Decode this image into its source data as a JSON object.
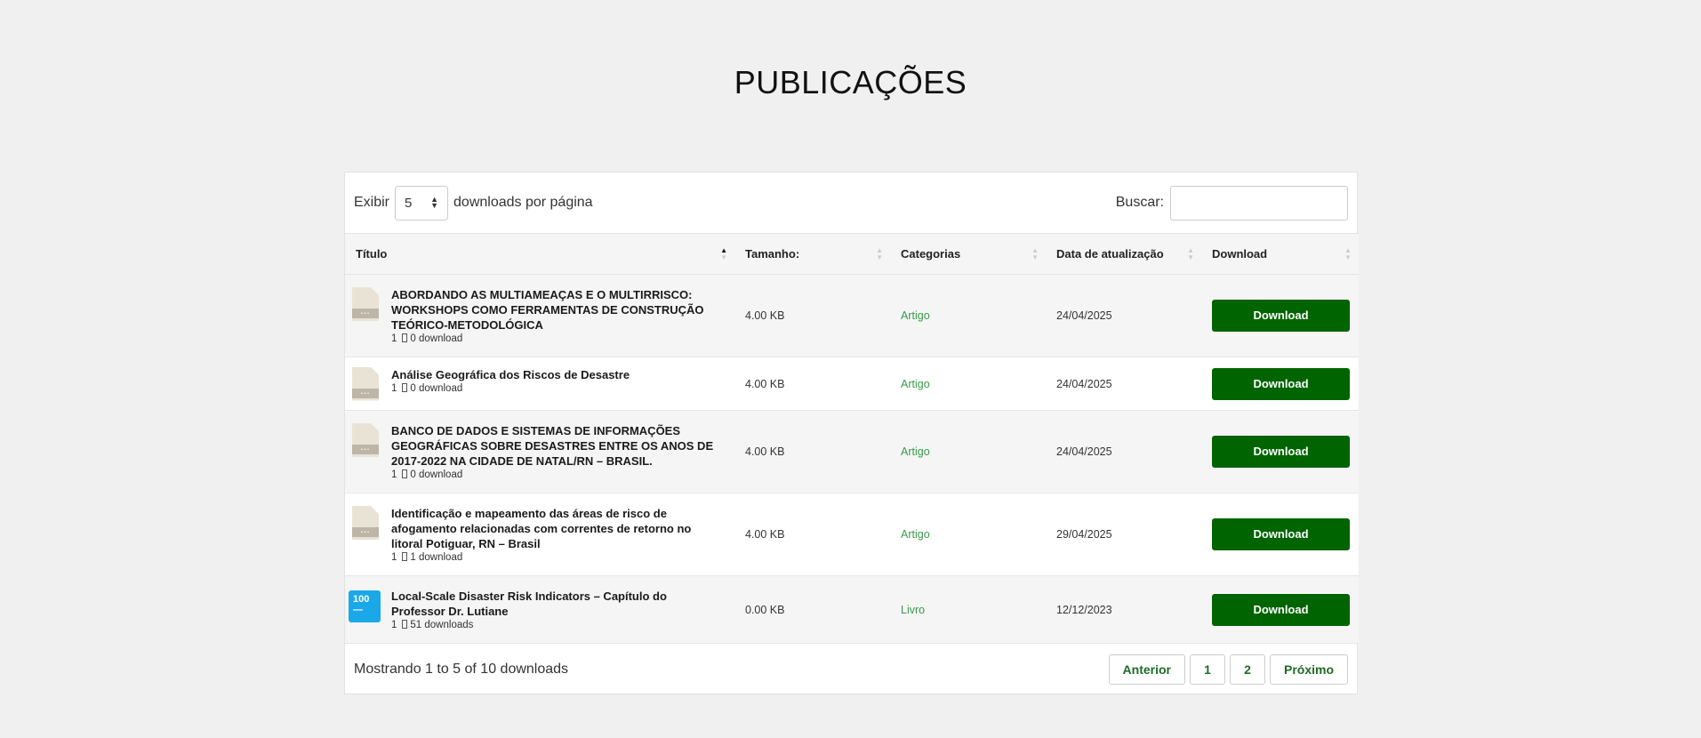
{
  "page": {
    "title": "PUBLICAÇÕES"
  },
  "controls": {
    "show_label": "Exibir",
    "page_length": "5",
    "per_page_label": "downloads por página",
    "search_label": "Buscar:",
    "search_value": ""
  },
  "columns": {
    "title": "Título",
    "size": "Tamanho:",
    "category": "Categorias",
    "date": "Data de atualização",
    "download": "Download"
  },
  "rows": [
    {
      "title": "ABORDANDO AS MULTIAMEAÇAS E O MULTIRRISCO: WORKSHOPS COMO FERRAMENTAS DE CONSTRUÇÃO TEÓRICO-METODOLÓGICA",
      "files": "1",
      "downloads": "0 download",
      "size": "4.00 KB",
      "category": "Artigo",
      "date": "24/04/2025",
      "button": "Download",
      "icon": "file-icon"
    },
    {
      "title": "Análise Geográfica dos Riscos de Desastre",
      "files": "1",
      "downloads": "0 download",
      "size": "4.00 KB",
      "category": "Artigo",
      "date": "24/04/2025",
      "button": "Download",
      "icon": "file-icon"
    },
    {
      "title": "BANCO DE DADOS E SISTEMAS DE INFORMAÇÕES GEOGRÁFICAS SOBRE DESASTRES ENTRE OS ANOS DE 2017-2022 NA CIDADE DE NATAL/RN – BRASIL.",
      "files": "1",
      "downloads": "0 download",
      "size": "4.00 KB",
      "category": "Artigo",
      "date": "24/04/2025",
      "button": "Download",
      "icon": "file-icon"
    },
    {
      "title": "Identificação e mapeamento das áreas de risco de afogamento relacionadas com correntes de retorno no litoral Potiguar, RN – Brasil",
      "files": "1",
      "downloads": "1 download",
      "size": "4.00 KB",
      "category": "Artigo",
      "date": "29/04/2025",
      "button": "Download",
      "icon": "file-icon"
    },
    {
      "title": "Local-Scale Disaster Risk Indicators – Capítulo do Professor Dr. Lutiane",
      "files": "1",
      "downloads": "51 downloads",
      "size": "0.00 KB",
      "category": "Livro",
      "date": "12/12/2023",
      "button": "Download",
      "icon": "badge-icon",
      "badge_text": "100"
    }
  ],
  "footer": {
    "info": "Mostrando 1 to 5 of 10 downloads",
    "prev": "Anterior",
    "pages": [
      "1",
      "2"
    ],
    "next": "Próximo"
  },
  "colors": {
    "button": "#006400",
    "category": "#3a9a4a",
    "pager_text": "#1e6a27",
    "badge": "#1ba8e8"
  }
}
